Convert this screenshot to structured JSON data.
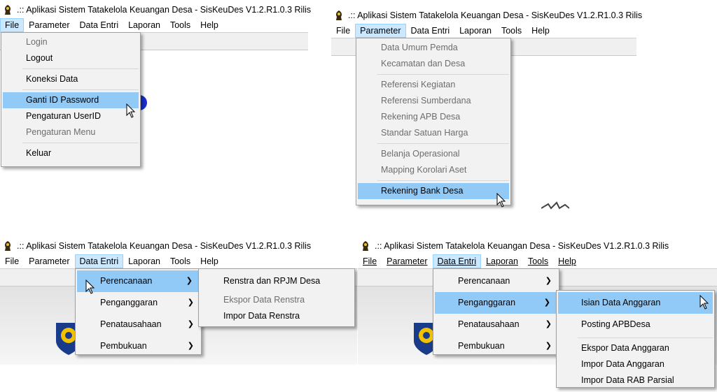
{
  "window_title": ".:: Aplikasi Sistem Tatakelola Keuangan Desa - SisKeuDes V1.2.R1.0.3 Rilis",
  "menubar": [
    "File",
    "Parameter",
    "Data Entri",
    "Laporan",
    "Tools",
    "Help"
  ],
  "file_menu": {
    "items": [
      "Login",
      "Logout",
      "Koneksi Data",
      "Ganti ID Password",
      "Pengaturan UserID",
      "Pengaturan Menu",
      "Keluar"
    ]
  },
  "parameter_menu": {
    "items": [
      "Data Umum Pemda",
      "Kecamatan dan Desa",
      "Referensi Kegiatan",
      "Referensi Sumberdana",
      "Rekening APB Desa",
      "Standar Satuan Harga",
      "Belanja Operasional",
      "Mapping Korolari Aset",
      "Rekening Bank Desa"
    ]
  },
  "data_entri_menu": {
    "items": [
      "Perencanaan",
      "Penganggaran",
      "Penatausahaan",
      "Pembukuan"
    ]
  },
  "perencanaan_submenu": {
    "items": [
      "Renstra dan RPJM Desa",
      "Ekspor Data Renstra",
      "Impor Data Renstra"
    ]
  },
  "penganggaran_submenu": {
    "items": [
      "Isian Data Anggaran",
      "Posting APBDesa",
      "Ekspor Data Anggaran",
      "Impor Data Anggaran",
      "Impor Data RAB Parsial"
    ]
  },
  "icons": [
    "app-icon",
    "pointer-cursor-icon",
    "submenu-arrow-icon",
    "emblem-logo-icon"
  ],
  "colors": {
    "highlight": "#91c9f7",
    "menubar_active": "#cce8ff",
    "disabled_text": "#6d6d6d"
  }
}
